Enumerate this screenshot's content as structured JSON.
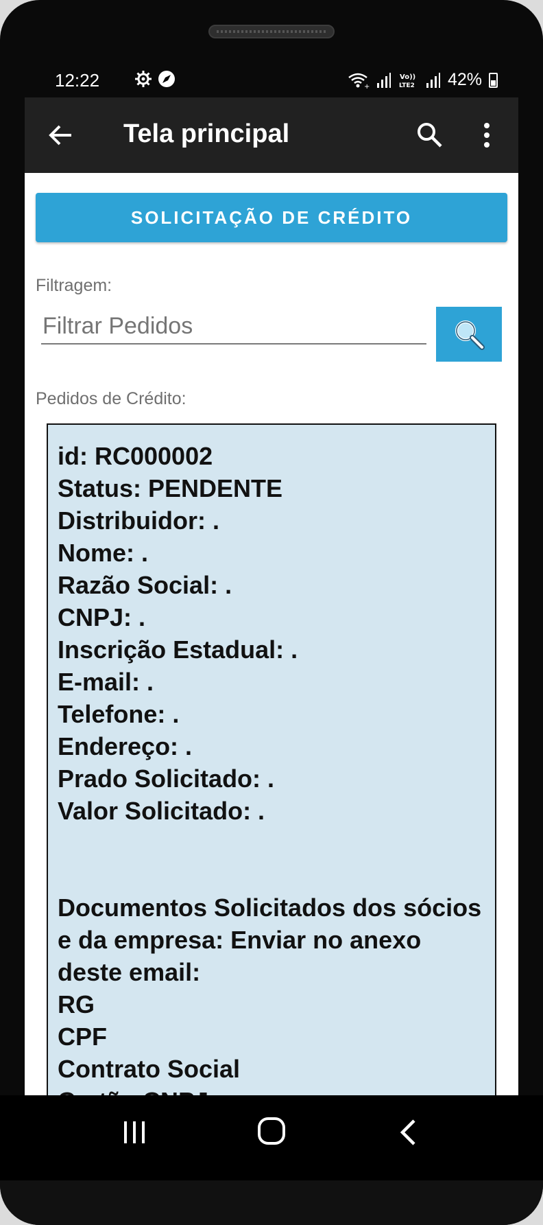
{
  "status_bar": {
    "time": "12:22",
    "battery": "42%"
  },
  "app_bar": {
    "title": "Tela principal"
  },
  "credit_button_label": "SOLICITAÇÃO DE CRÉDITO",
  "filter": {
    "label": "Filtragem:",
    "placeholder": "Filtrar Pedidos",
    "value": ""
  },
  "orders": {
    "label": "Pedidos de Crédito:",
    "items": [
      {
        "id": "id: RC000002",
        "status": "Status: PENDENTE",
        "distribuidor": "Distribuidor: .",
        "nome": "Nome: .",
        "razao_social": "Razão Social: .",
        "cnpj": "CNPJ: .",
        "inscricao_estadual": "Inscrição Estadual: .",
        "email": "E-mail: .",
        "telefone": "Telefone: .",
        "endereco": "Endereço: .",
        "prado_solicitado": "Prado Solicitado: .",
        "valor_solicitado": "Valor Solicitado: .",
        "documentos": "Documentos Solicitados dos sócios e da empresa: Enviar no anexo deste email:",
        "doc_rg": "RG",
        "doc_cpf": "CPF",
        "doc_contrato": "Contrato Social",
        "doc_cartao_cnpj": "Cartão CNPJ"
      }
    ]
  }
}
